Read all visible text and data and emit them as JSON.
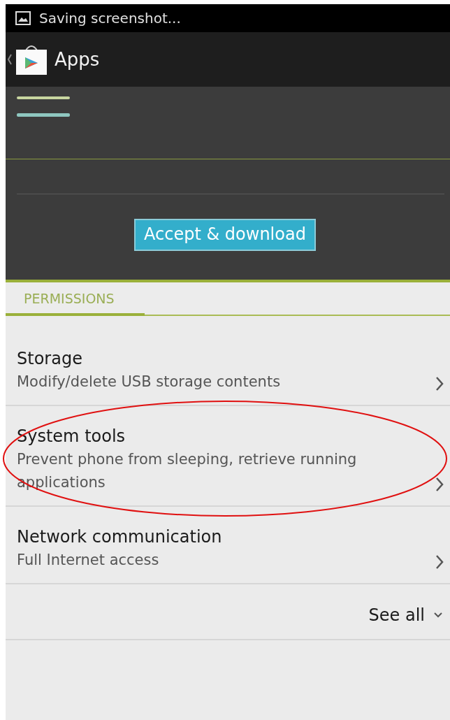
{
  "status_bar": {
    "text": "Saving screenshot..."
  },
  "action_bar": {
    "title": "Apps"
  },
  "install": {
    "button": "Accept & download"
  },
  "tabs": [
    {
      "label": "PERMISSIONS",
      "selected": true
    }
  ],
  "permissions": [
    {
      "title": "Storage",
      "description": "Modify/delete USB storage contents"
    },
    {
      "title": "System tools",
      "description": "Prevent phone from sleeping, retrieve running applications"
    },
    {
      "title": "Network communication",
      "description": "Full Internet access"
    }
  ],
  "see_all": "See all",
  "annotation": {
    "kind": "ellipse"
  }
}
